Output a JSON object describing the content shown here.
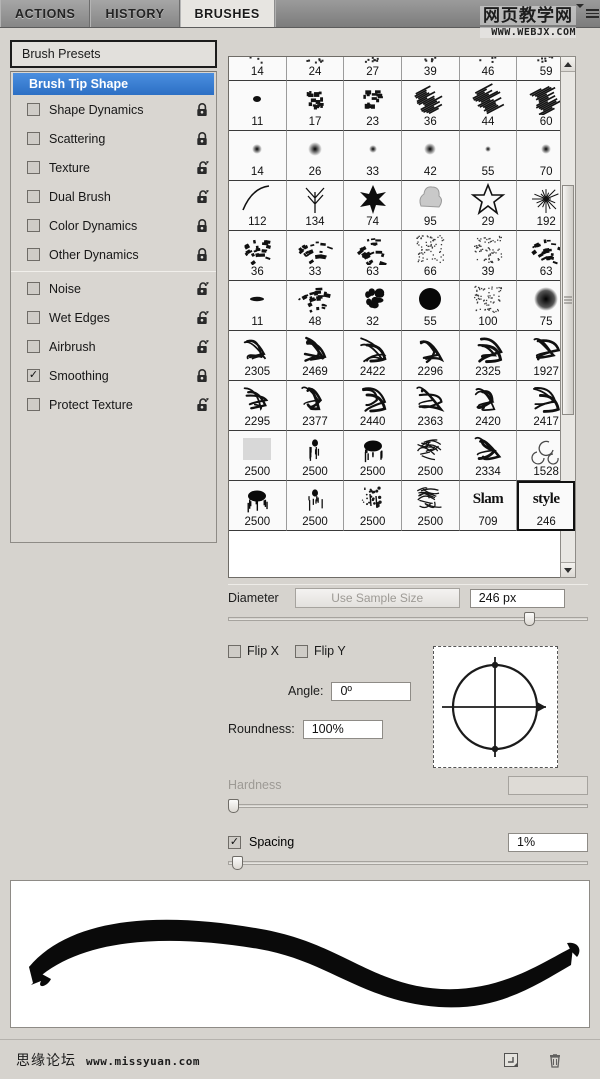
{
  "tabs": [
    {
      "label": "ACTIONS",
      "active": false
    },
    {
      "label": "HISTORY",
      "active": false
    },
    {
      "label": "BRUSHES",
      "active": true
    }
  ],
  "watermark_top": {
    "cn": "网页教学网",
    "url": "WWW.WEBJX.COM"
  },
  "watermark_bottom": {
    "cn": "思缘论坛",
    "url": "www.missyuan.com"
  },
  "presets_label": "Brush Presets",
  "options": [
    {
      "label": "Brush Tip Shape",
      "selected": true,
      "checkbox": false,
      "checked": false,
      "lock": "none",
      "sep_after": false
    },
    {
      "label": "Shape Dynamics",
      "selected": false,
      "checkbox": true,
      "checked": false,
      "lock": "closed",
      "sep_after": false
    },
    {
      "label": "Scattering",
      "selected": false,
      "checkbox": true,
      "checked": false,
      "lock": "closed",
      "sep_after": false
    },
    {
      "label": "Texture",
      "selected": false,
      "checkbox": true,
      "checked": false,
      "lock": "open",
      "sep_after": false
    },
    {
      "label": "Dual Brush",
      "selected": false,
      "checkbox": true,
      "checked": false,
      "lock": "open",
      "sep_after": false
    },
    {
      "label": "Color Dynamics",
      "selected": false,
      "checkbox": true,
      "checked": false,
      "lock": "closed",
      "sep_after": false
    },
    {
      "label": "Other Dynamics",
      "selected": false,
      "checkbox": true,
      "checked": false,
      "lock": "closed",
      "sep_after": true
    },
    {
      "label": "Noise",
      "selected": false,
      "checkbox": true,
      "checked": false,
      "lock": "open",
      "sep_after": false
    },
    {
      "label": "Wet Edges",
      "selected": false,
      "checkbox": true,
      "checked": false,
      "lock": "open",
      "sep_after": false
    },
    {
      "label": "Airbrush",
      "selected": false,
      "checkbox": true,
      "checked": false,
      "lock": "open",
      "sep_after": false
    },
    {
      "label": "Smoothing",
      "selected": false,
      "checkbox": true,
      "checked": true,
      "lock": "closed",
      "sep_after": false
    },
    {
      "label": "Protect Texture",
      "selected": false,
      "checkbox": true,
      "checked": false,
      "lock": "open",
      "sep_after": false
    }
  ],
  "brush_grid": {
    "rows": [
      {
        "clipped": true,
        "cells": [
          {
            "size": "14",
            "thumb": "scatter-small"
          },
          {
            "size": "24",
            "thumb": "scatter-small"
          },
          {
            "size": "27",
            "thumb": "scatter-small"
          },
          {
            "size": "39",
            "thumb": "scatter-small"
          },
          {
            "size": "46",
            "thumb": "scatter-small"
          },
          {
            "size": "59",
            "thumb": "scatter-small"
          }
        ]
      },
      {
        "clipped": false,
        "cells": [
          {
            "size": "11",
            "thumb": "chalk-dot"
          },
          {
            "size": "17",
            "thumb": "chalk-blob"
          },
          {
            "size": "23",
            "thumb": "chalk-blob"
          },
          {
            "size": "36",
            "thumb": "chalk-streak"
          },
          {
            "size": "44",
            "thumb": "chalk-streak"
          },
          {
            "size": "60",
            "thumb": "chalk-streak"
          }
        ]
      },
      {
        "clipped": false,
        "cells": [
          {
            "size": "14",
            "thumb": "soft-dot"
          },
          {
            "size": "26",
            "thumb": "soft-dot"
          },
          {
            "size": "33",
            "thumb": "soft-dot"
          },
          {
            "size": "42",
            "thumb": "soft-dot"
          },
          {
            "size": "55",
            "thumb": "soft-dot"
          },
          {
            "size": "70",
            "thumb": "soft-dot"
          }
        ]
      },
      {
        "clipped": false,
        "cells": [
          {
            "size": "112",
            "thumb": "arc"
          },
          {
            "size": "134",
            "thumb": "grass"
          },
          {
            "size": "74",
            "thumb": "leaf"
          },
          {
            "size": "95",
            "thumb": "cloud"
          },
          {
            "size": "29",
            "thumb": "star"
          },
          {
            "size": "192",
            "thumb": "burst"
          }
        ]
      },
      {
        "clipped": false,
        "cells": [
          {
            "size": "36",
            "thumb": "rough"
          },
          {
            "size": "33",
            "thumb": "rough"
          },
          {
            "size": "63",
            "thumb": "rough"
          },
          {
            "size": "66",
            "thumb": "speckle"
          },
          {
            "size": "39",
            "thumb": "speckle"
          },
          {
            "size": "63",
            "thumb": "rough"
          }
        ]
      },
      {
        "clipped": false,
        "cells": [
          {
            "size": "11",
            "thumb": "dash"
          },
          {
            "size": "48",
            "thumb": "rough"
          },
          {
            "size": "32",
            "thumb": "blob"
          },
          {
            "size": "55",
            "thumb": "hard-circle"
          },
          {
            "size": "100",
            "thumb": "speckle"
          },
          {
            "size": "75",
            "thumb": "soft-round"
          }
        ]
      },
      {
        "clipped": false,
        "cells": [
          {
            "size": "2305",
            "thumb": "graffiti"
          },
          {
            "size": "2469",
            "thumb": "graffiti"
          },
          {
            "size": "2422",
            "thumb": "graffiti"
          },
          {
            "size": "2296",
            "thumb": "graffiti"
          },
          {
            "size": "2325",
            "thumb": "graffiti"
          },
          {
            "size": "1927",
            "thumb": "graffiti"
          }
        ]
      },
      {
        "clipped": false,
        "cells": [
          {
            "size": "2295",
            "thumb": "graffiti"
          },
          {
            "size": "2377",
            "thumb": "graffiti"
          },
          {
            "size": "2440",
            "thumb": "graffiti"
          },
          {
            "size": "2363",
            "thumb": "graffiti"
          },
          {
            "size": "2420",
            "thumb": "graffiti"
          },
          {
            "size": "2417",
            "thumb": "graffiti"
          }
        ]
      },
      {
        "clipped": false,
        "cells": [
          {
            "size": "2500",
            "thumb": "flat"
          },
          {
            "size": "2500",
            "thumb": "drip"
          },
          {
            "size": "2500",
            "thumb": "splat"
          },
          {
            "size": "2500",
            "thumb": "scribble"
          },
          {
            "size": "2334",
            "thumb": "graffiti"
          },
          {
            "size": "1528",
            "thumb": "swirl"
          }
        ]
      },
      {
        "clipped": false,
        "cells": [
          {
            "size": "2500",
            "thumb": "splat"
          },
          {
            "size": "2500",
            "thumb": "drip"
          },
          {
            "size": "2500",
            "thumb": "spray"
          },
          {
            "size": "2500",
            "thumb": "scribble"
          },
          {
            "size": "709",
            "thumb": "text",
            "text": "Slam"
          },
          {
            "size": "246",
            "thumb": "text",
            "text": "style",
            "selected": true
          }
        ]
      }
    ]
  },
  "controls": {
    "diameter_label": "Diameter",
    "use_sample_size_label": "Use Sample Size",
    "diameter_value": "246 px",
    "diameter_percent": 84,
    "flip_x_label": "Flip X",
    "flip_x_checked": false,
    "flip_y_label": "Flip Y",
    "flip_y_checked": false,
    "angle_label": "Angle:",
    "angle_value": "0º",
    "roundness_label": "Roundness:",
    "roundness_value": "100%",
    "hardness_label": "Hardness",
    "hardness_value": "",
    "hardness_percent": 0,
    "hardness_enabled": false,
    "spacing_label": "Spacing",
    "spacing_checked": true,
    "spacing_value": "1%",
    "spacing_percent": 1
  },
  "bottom_icons": [
    {
      "name": "new-brush-icon"
    },
    {
      "name": "trash-icon"
    }
  ]
}
